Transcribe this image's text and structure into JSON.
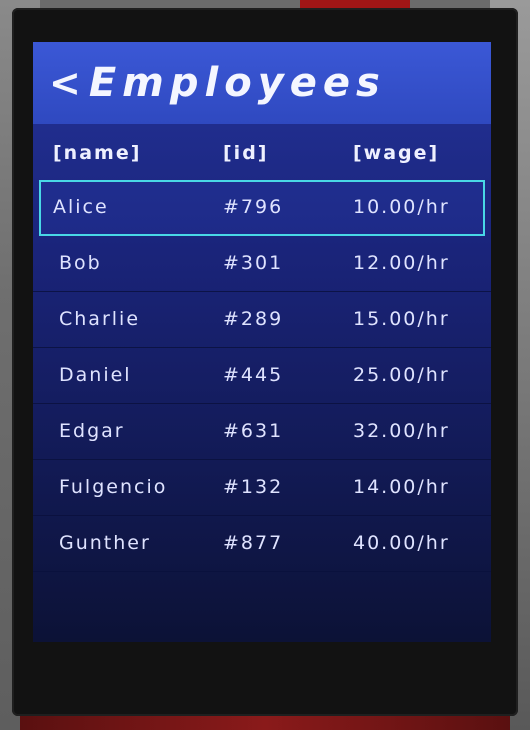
{
  "app": {
    "back_symbol": "<",
    "title": "Employees"
  },
  "table": {
    "headers": {
      "name": "[name]",
      "id": "[id]",
      "wage": "[wage]"
    },
    "selected_index": 0,
    "rows": [
      {
        "name": "Alice",
        "id": "#796",
        "wage": "10.00/hr"
      },
      {
        "name": "Bob",
        "id": "#301",
        "wage": "12.00/hr"
      },
      {
        "name": "Charlie",
        "id": "#289",
        "wage": "15.00/hr"
      },
      {
        "name": "Daniel",
        "id": "#445",
        "wage": "25.00/hr"
      },
      {
        "name": "Edgar",
        "id": "#631",
        "wage": "32.00/hr"
      },
      {
        "name": "Fulgencio",
        "id": "#132",
        "wage": "14.00/hr"
      },
      {
        "name": "Gunther",
        "id": "#877",
        "wage": "40.00/hr"
      }
    ]
  },
  "colors": {
    "title_bar": "#3b58d6",
    "selection_outline": "#49d8e6",
    "text": "#dfe3ff"
  }
}
